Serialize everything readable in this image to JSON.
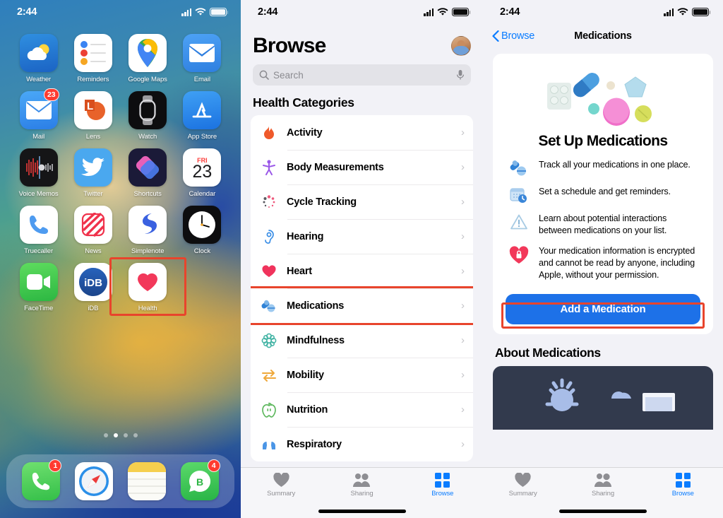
{
  "status_bar": {
    "time": "2:44",
    "signal_icon": "cellular-bars-icon",
    "wifi_icon": "wifi-icon",
    "battery_icon": "battery-full-icon"
  },
  "home_screen": {
    "apps_rows": [
      [
        {
          "label": "Weather",
          "icon": "weather-app-icon"
        },
        {
          "label": "Reminders",
          "icon": "reminders-app-icon"
        },
        {
          "label": "Google Maps",
          "icon": "google-maps-app-icon"
        },
        {
          "label": "Email",
          "icon": "email-app-icon"
        }
      ],
      [
        {
          "label": "Mail",
          "icon": "mail-app-icon",
          "badge": "23"
        },
        {
          "label": "Lens",
          "icon": "lens-app-icon"
        },
        {
          "label": "Watch",
          "icon": "watch-app-icon"
        },
        {
          "label": "App Store",
          "icon": "app-store-app-icon"
        }
      ],
      [
        {
          "label": "Voice Memos",
          "icon": "voice-memos-app-icon"
        },
        {
          "label": "Twitter",
          "icon": "twitter-app-icon"
        },
        {
          "label": "Shortcuts",
          "icon": "shortcuts-app-icon"
        },
        {
          "label": "Calendar",
          "icon": "calendar-app-icon",
          "calendar_day": "23",
          "calendar_weekday": "FRI"
        }
      ],
      [
        {
          "label": "FaceTime",
          "icon": "facetime-app-icon"
        },
        {
          "label": "iDB",
          "icon": "idb-app-icon",
          "glyph": "iDB"
        },
        {
          "label": "Health",
          "icon": "health-app-icon",
          "highlighted": true
        }
      ]
    ],
    "page_dots": {
      "count": 4,
      "active_index": 1
    },
    "dock": [
      {
        "label": "Phone",
        "icon": "phone-app-icon",
        "badge": "1"
      },
      {
        "label": "Safari",
        "icon": "safari-app-icon"
      },
      {
        "label": "Notes",
        "icon": "notes-app-icon"
      },
      {
        "label": "WhatsApp Business",
        "icon": "whatsapp-business-app-icon",
        "badge": "4"
      }
    ]
  },
  "browse_screen": {
    "title": "Browse",
    "avatar": "profile-avatar",
    "search": {
      "placeholder": "Search",
      "icon": "search-icon",
      "mic_icon": "microphone-icon"
    },
    "section_title": "Health Categories",
    "categories": [
      {
        "label": "Activity",
        "icon": "activity-flame-icon",
        "color": "#ef5a2b"
      },
      {
        "label": "Body Measurements",
        "icon": "body-figure-icon",
        "color": "#9b59e8"
      },
      {
        "label": "Cycle Tracking",
        "icon": "cycle-tracking-icon",
        "color": "#ee5a7d"
      },
      {
        "label": "Hearing",
        "icon": "ear-icon",
        "color": "#3a8ee6"
      },
      {
        "label": "Heart",
        "icon": "heart-icon",
        "color": "#f0335c"
      },
      {
        "label": "Medications",
        "icon": "medications-pills-icon",
        "color": "#4a95e6",
        "highlighted": true
      },
      {
        "label": "Mindfulness",
        "icon": "mindfulness-icon",
        "color": "#46b5a6"
      },
      {
        "label": "Mobility",
        "icon": "mobility-arrows-icon",
        "color": "#efa83a"
      },
      {
        "label": "Nutrition",
        "icon": "nutrition-apple-icon",
        "color": "#5eb85e"
      },
      {
        "label": "Respiratory",
        "icon": "respiratory-lungs-icon",
        "color": "#4a95e6"
      }
    ],
    "tabs": [
      {
        "label": "Summary",
        "icon": "heart-tab-icon",
        "active": false
      },
      {
        "label": "Sharing",
        "icon": "people-tab-icon",
        "active": false
      },
      {
        "label": "Browse",
        "icon": "grid-tab-icon",
        "active": true
      }
    ]
  },
  "medications_screen": {
    "back_label": "Browse",
    "back_icon": "chevron-left-icon",
    "nav_title": "Medications",
    "hero_icon": "pills-assortment-icon",
    "setup_title": "Set Up Medications",
    "features": [
      {
        "icon": "pills-icon",
        "text": "Track all your medications in one place."
      },
      {
        "icon": "calendar-clock-icon",
        "text": "Set a schedule and get reminders."
      },
      {
        "icon": "warning-triangle-icon",
        "text": "Learn about potential interactions between medications on your list."
      },
      {
        "icon": "heart-lock-icon",
        "text": "Your medication information is encrypted and cannot be read by anyone, including Apple, without your permission."
      }
    ],
    "cta_label": "Add a Medication",
    "about_title": "About Medications",
    "tabs": [
      {
        "label": "Summary",
        "icon": "heart-tab-icon",
        "active": false
      },
      {
        "label": "Sharing",
        "icon": "people-tab-icon",
        "active": false
      },
      {
        "label": "Browse",
        "icon": "grid-tab-icon",
        "active": true
      }
    ]
  },
  "annotations": {
    "highlight_color": "#e8442c"
  }
}
